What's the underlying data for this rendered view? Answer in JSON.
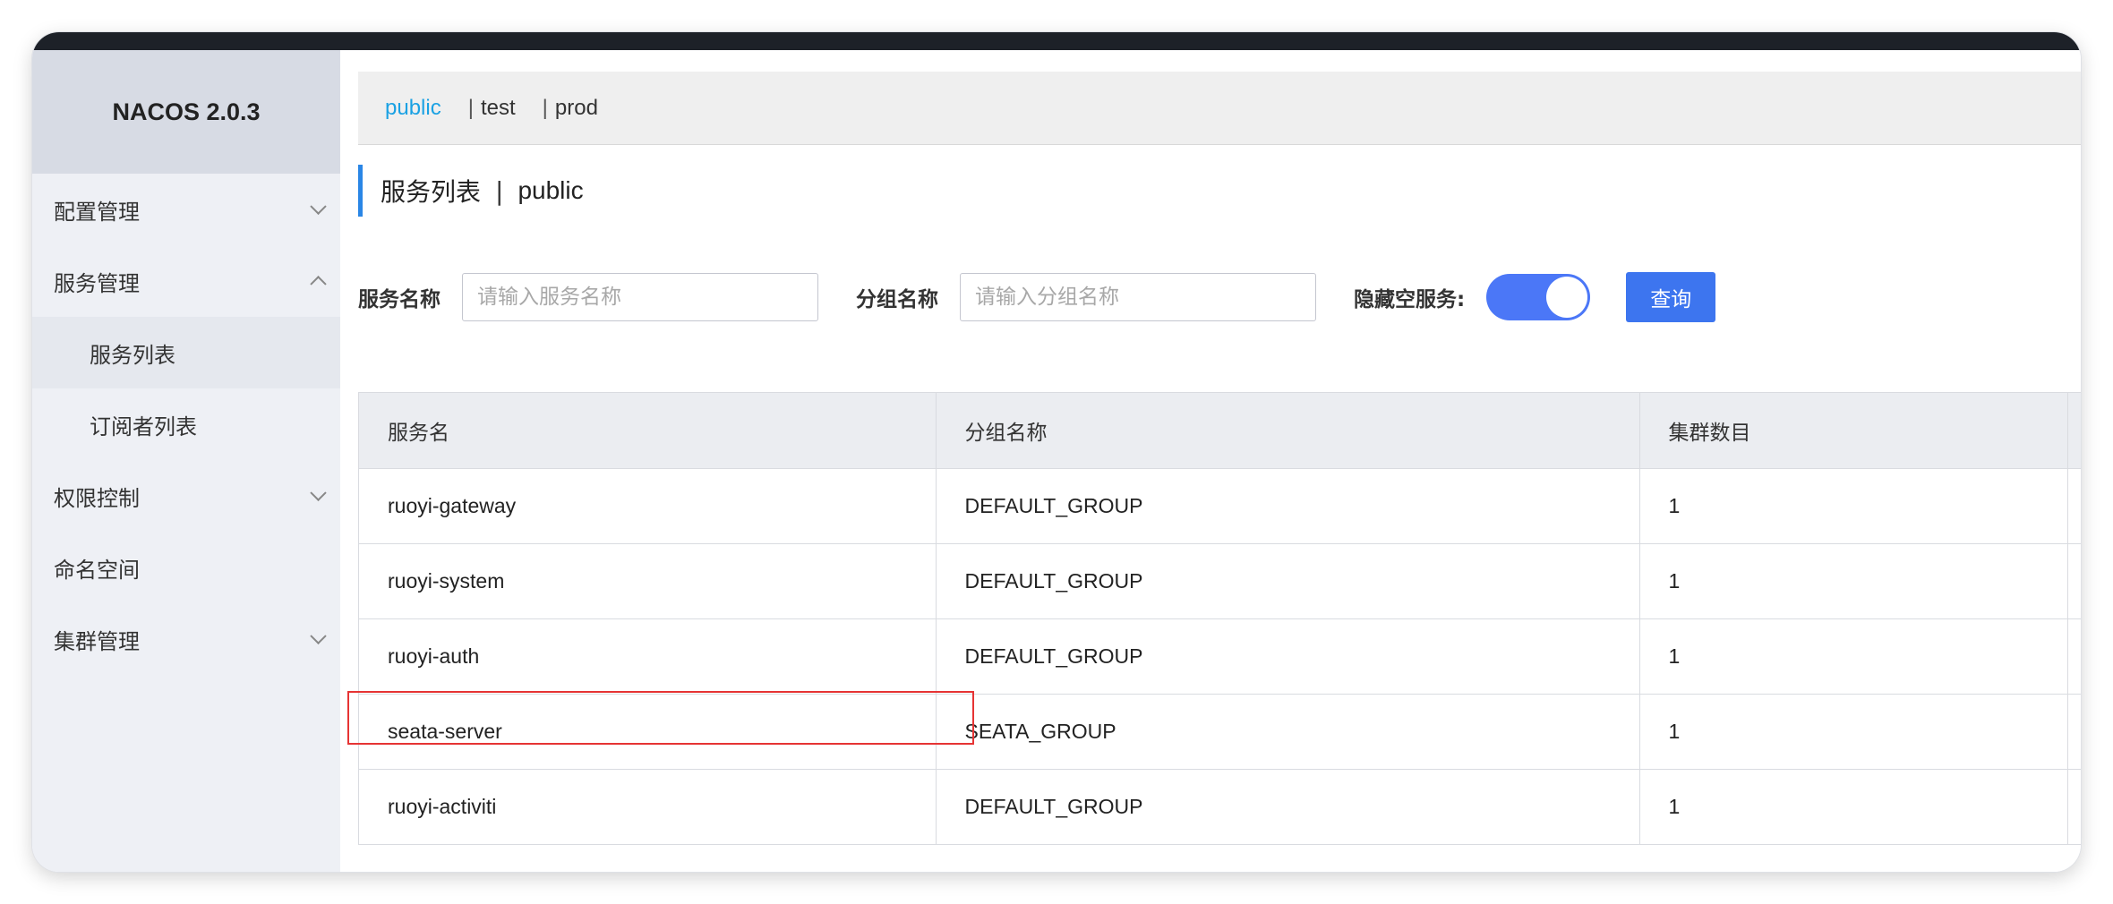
{
  "app": {
    "logo": "NACOS 2.0.3"
  },
  "sidebar": {
    "items": [
      {
        "label": "配置管理",
        "chevron": "chevron-down-icon"
      },
      {
        "label": "服务管理",
        "chevron": "chevron-up-icon"
      },
      {
        "label": "服务列表"
      },
      {
        "label": "订阅者列表"
      },
      {
        "label": "权限控制",
        "chevron": "chevron-down-icon"
      },
      {
        "label": "命名空间"
      },
      {
        "label": "集群管理",
        "chevron": "chevron-down-icon"
      }
    ]
  },
  "namespaces": {
    "items": [
      "public",
      "test",
      "prod"
    ],
    "separator": "|",
    "active_color": "#1aa1e3"
  },
  "page": {
    "title": "服务列表",
    "separator": "|",
    "namespace": "public"
  },
  "filters": {
    "service_name_label": "服务名称",
    "service_name_placeholder": "请输入服务名称",
    "group_name_label": "分组名称",
    "group_name_placeholder": "请输入分组名称",
    "hide_empty_label": "隐藏空服务:",
    "query_button": "查询"
  },
  "table": {
    "headers": [
      "服务名",
      "分组名称",
      "集群数目",
      ""
    ],
    "rows": [
      [
        "ruoyi-gateway",
        "DEFAULT_GROUP",
        "1"
      ],
      [
        "ruoyi-system",
        "DEFAULT_GROUP",
        "1"
      ],
      [
        "ruoyi-auth",
        "DEFAULT_GROUP",
        "1"
      ],
      [
        "seata-server",
        "SEATA_GROUP",
        "1"
      ],
      [
        "ruoyi-activiti",
        "DEFAULT_GROUP",
        "1"
      ]
    ]
  },
  "colors": {
    "accent": "#3d75ef",
    "highlight_box": "#e63434"
  }
}
